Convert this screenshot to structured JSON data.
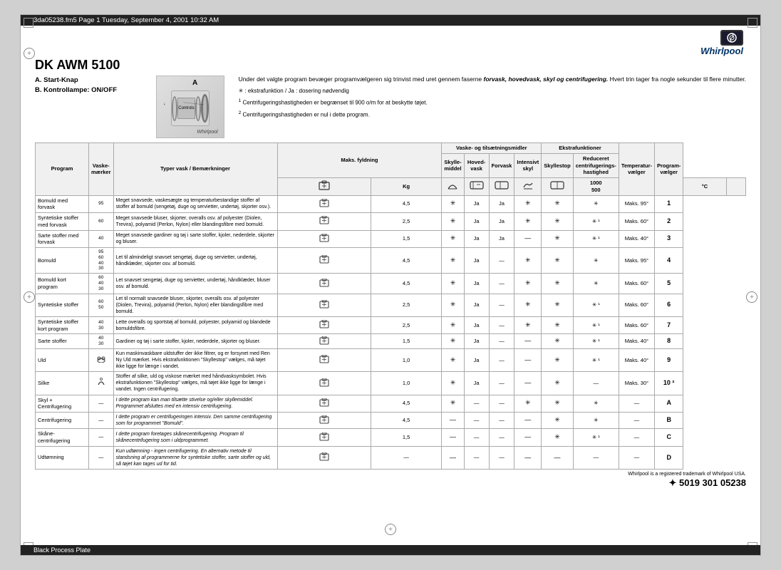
{
  "top_bar": {
    "text": "3da05238.fm5  Page 1  Tuesday, September 4, 2001  10:32 AM"
  },
  "bottom_bar": {
    "text": "Black Process Plate"
  },
  "logo": {
    "brand": "Whirlpool"
  },
  "model": {
    "title": "DK    AWM 5100"
  },
  "labels": [
    "A. Start-Knap",
    "B. Kontrollampe: ON/OFF"
  ],
  "description": {
    "main": "Under det valgte program bevæger programvælgeren sig trinvist med uret gennem faserne forvask, hovedvask, skyl og centrifugering. Hvert trin tager fra nogle sekunder til flere minutter.",
    "note1": "✳ : ekstrafunktion / Ja : dosering nødvendig",
    "note2": "¹ Centrifugeringshastigheden er begrænset til 900 o/m for at beskytte tøjet.",
    "note3": "² Centrifugeringshastigheden er nul i dette program."
  },
  "table": {
    "header_groups": {
      "vaske_label": "Vaske- og tilsætningsmidler",
      "ekstra_label": "Ekstrafunktioner",
      "temp_label": "Temperatur- vælger",
      "prog_label": "Program- vælger"
    },
    "col_headers": {
      "program": "Program",
      "vaske": "Vaskemærker",
      "typer": "Typer vask / Bemærkninger",
      "maks_fyld": "Maks. fyldning",
      "kg": "Kg",
      "skyl": "Skylle- middel",
      "hoved": "Hoved- vask",
      "forv": "Forvask",
      "intens": "Intensivt skyl",
      "skylle_stop": "Skyllestop",
      "red_cent": "Reduceret centrifugerings- hastighed",
      "red_sub1": "1000",
      "red_sub2": "500",
      "temp": "°C",
      "prog": ""
    },
    "rows": [
      {
        "program": "Bomuld med forvask",
        "marks": "95",
        "type": "Meget snavsede, vaskesægte og temperaturbestandige stoffer af stoffer af bomuld (sengetøj, duge og servietter, undertøj, skjorter osv.).",
        "kg": "4,5",
        "skyl": "✳",
        "hoved": "Ja",
        "forv": "Ja",
        "intens": "✳",
        "skylle_stop": "✳",
        "red": "✳",
        "temp": "Maks. 95°",
        "prog": "1"
      },
      {
        "program": "Syntetiske stoffer med forvask",
        "marks": "60",
        "type": "Meget snavsede bluser, skjorter, overalls osv. af polyester (Diolen, Trevira), polyamid (Perlon, Nylon) eller blandingsfibre med bomuld.",
        "kg": "2,5",
        "skyl": "✳",
        "hoved": "Ja",
        "forv": "Ja",
        "intens": "✳",
        "skylle_stop": "✳",
        "red": "✳ ¹",
        "temp": "Maks. 60°",
        "prog": "2"
      },
      {
        "program": "Sarte stoffer med forvask",
        "marks": "40",
        "type": "Meget snavsede gardiner og tøj i sarte stoffer, kjoler, nederdele, skjorter og bluser.",
        "kg": "1,5",
        "skyl": "✳",
        "hoved": "Ja",
        "forv": "Ja",
        "intens": "—",
        "skylle_stop": "✳",
        "red": "✳ ¹",
        "temp": "Maks. 40°",
        "prog": "3"
      },
      {
        "program": "Bomuld",
        "marks": "95 60 40 30",
        "type": "Let til almindeligt snavset sengetøj, duge og servietter, undertøj, håndklæder, skjorter osv. af bomuld.",
        "kg": "4,5",
        "skyl": "✳",
        "hoved": "Ja",
        "forv": "—",
        "intens": "✳",
        "skylle_stop": "✳",
        "red": "✳",
        "temp": "Maks. 95°",
        "prog": "4"
      },
      {
        "program": "Bomuld kort program",
        "marks": "60 40 30",
        "type": "Let snavset sengetøj, duge og servietter, undertøj, håndklæder, bluser osv. af bomuld.",
        "kg": "4,5",
        "skyl": "✳",
        "hoved": "Ja",
        "forv": "—",
        "intens": "✳",
        "skylle_stop": "✳",
        "red": "✳",
        "temp": "Maks. 60°",
        "prog": "5"
      },
      {
        "program": "Syntetiske stoffer",
        "marks": "60 50",
        "type": "Let til normalt snavsede bluser, skjorter, overalls osv. af polyester (Diolen, Trevira), polyamid (Perlon, Nylon) eller blandingsfibre med bomuld.",
        "kg": "2,5",
        "skyl": "✳",
        "hoved": "Ja",
        "forv": "—",
        "intens": "✳",
        "skylle_stop": "✳",
        "red": "✳ ¹",
        "temp": "Maks. 60°",
        "prog": "6"
      },
      {
        "program": "Syntetiske stoffer kort program",
        "marks": "40 30",
        "type": "Lette overalls og sportstøj af bomuld, polyester, polyamid og blandede bomuldsfibre.",
        "kg": "2,5",
        "skyl": "✳",
        "hoved": "Ja",
        "forv": "—",
        "intens": "✳",
        "skylle_stop": "✳",
        "red": "✳ ¹",
        "temp": "Maks. 60°",
        "prog": "7"
      },
      {
        "program": "Sarte stoffer",
        "marks": "40 30",
        "type": "Gardiner og tøj i sarte stoffer, kjoler, nederdele, skjorter og bluser.",
        "kg": "1,5",
        "skyl": "✳",
        "hoved": "Ja",
        "forv": "—",
        "intens": "—",
        "skylle_stop": "✳",
        "red": "✳ ¹",
        "temp": "Maks. 40°",
        "prog": "8"
      },
      {
        "program": "Uld",
        "marks": "uld",
        "type": "Kun maskinvaskbare uldstuffer der ikke filtrer, og er forsynet med Ren Ny Uld mærket. Hvis ekstrafunktionen \"Skyllestop\" vælges, må tøjet ikke ligge for længe i vandet.",
        "kg": "1,0",
        "skyl": "✳",
        "hoved": "Ja",
        "forv": "—",
        "intens": "—",
        "skylle_stop": "✳",
        "red": "✳ ¹",
        "temp": "Maks. 40°",
        "prog": "9"
      },
      {
        "program": "Silke",
        "marks": "silke",
        "type": "Stoffer af silke, uld og viskose mærket med håndvasksymbolet. Hvis ekstrafunktionen \"Skyllestop\" vælges, må tøjet ikke ligge for længe i vandet. Ingen centrifugering.",
        "kg": "1,0",
        "skyl": "✳",
        "hoved": "Ja",
        "forv": "—",
        "intens": "—",
        "skylle_stop": "✳",
        "red": "—",
        "temp": "Maks. 30°",
        "prog": "10 ²"
      },
      {
        "program": "Skyl + Centrifugering",
        "marks": "—",
        "type": "I dette program kan man tilsætte stivelse og/eller skyllemiddel. Programmet afsluttes med en intensiv centrifugering.",
        "kg": "4,5",
        "skyl": "✳",
        "hoved": "—",
        "forv": "—",
        "intens": "✳",
        "skylle_stop": "✳",
        "red": "✳",
        "temp": "—",
        "prog": "A"
      },
      {
        "program": "Centrifugering",
        "marks": "—",
        "type": "I dette program er centrifugeringen intensiv. Den samme centrifugering som for programmet \"Bomuld\".",
        "kg": "4,5",
        "skyl": "—",
        "hoved": "—",
        "forv": "—",
        "intens": "—",
        "skylle_stop": "✳",
        "red": "✳",
        "temp": "—",
        "prog": "B"
      },
      {
        "program": "Skåne-centrifugering",
        "marks": "—",
        "type": "I dette program foretages skånecentrifugering. Program til skånecentrifugering som i uldprogrammet.",
        "kg": "1,5",
        "skyl": "—",
        "hoved": "—",
        "forv": "—",
        "intens": "—",
        "skylle_stop": "✳",
        "red": "✳ ¹",
        "temp": "—",
        "prog": "C"
      },
      {
        "program": "Udtømning",
        "marks": "—",
        "type": "Kun udtømning - ingen centrifugering. En alternativ metode til standsning af programmerne for syntetiske stoffer, sarte stoffer og uld, så tøjet kan tages ud for tid.",
        "kg": "—",
        "skyl": "—",
        "hoved": "—",
        "forv": "—",
        "intens": "—",
        "skylle_stop": "—",
        "red": "—",
        "temp": "—",
        "prog": "D"
      }
    ],
    "footer": {
      "trademark": "Whirlpool is a registered trademark of Whirlpool USA.",
      "barcode": "✦ 5019 301 05238"
    }
  }
}
